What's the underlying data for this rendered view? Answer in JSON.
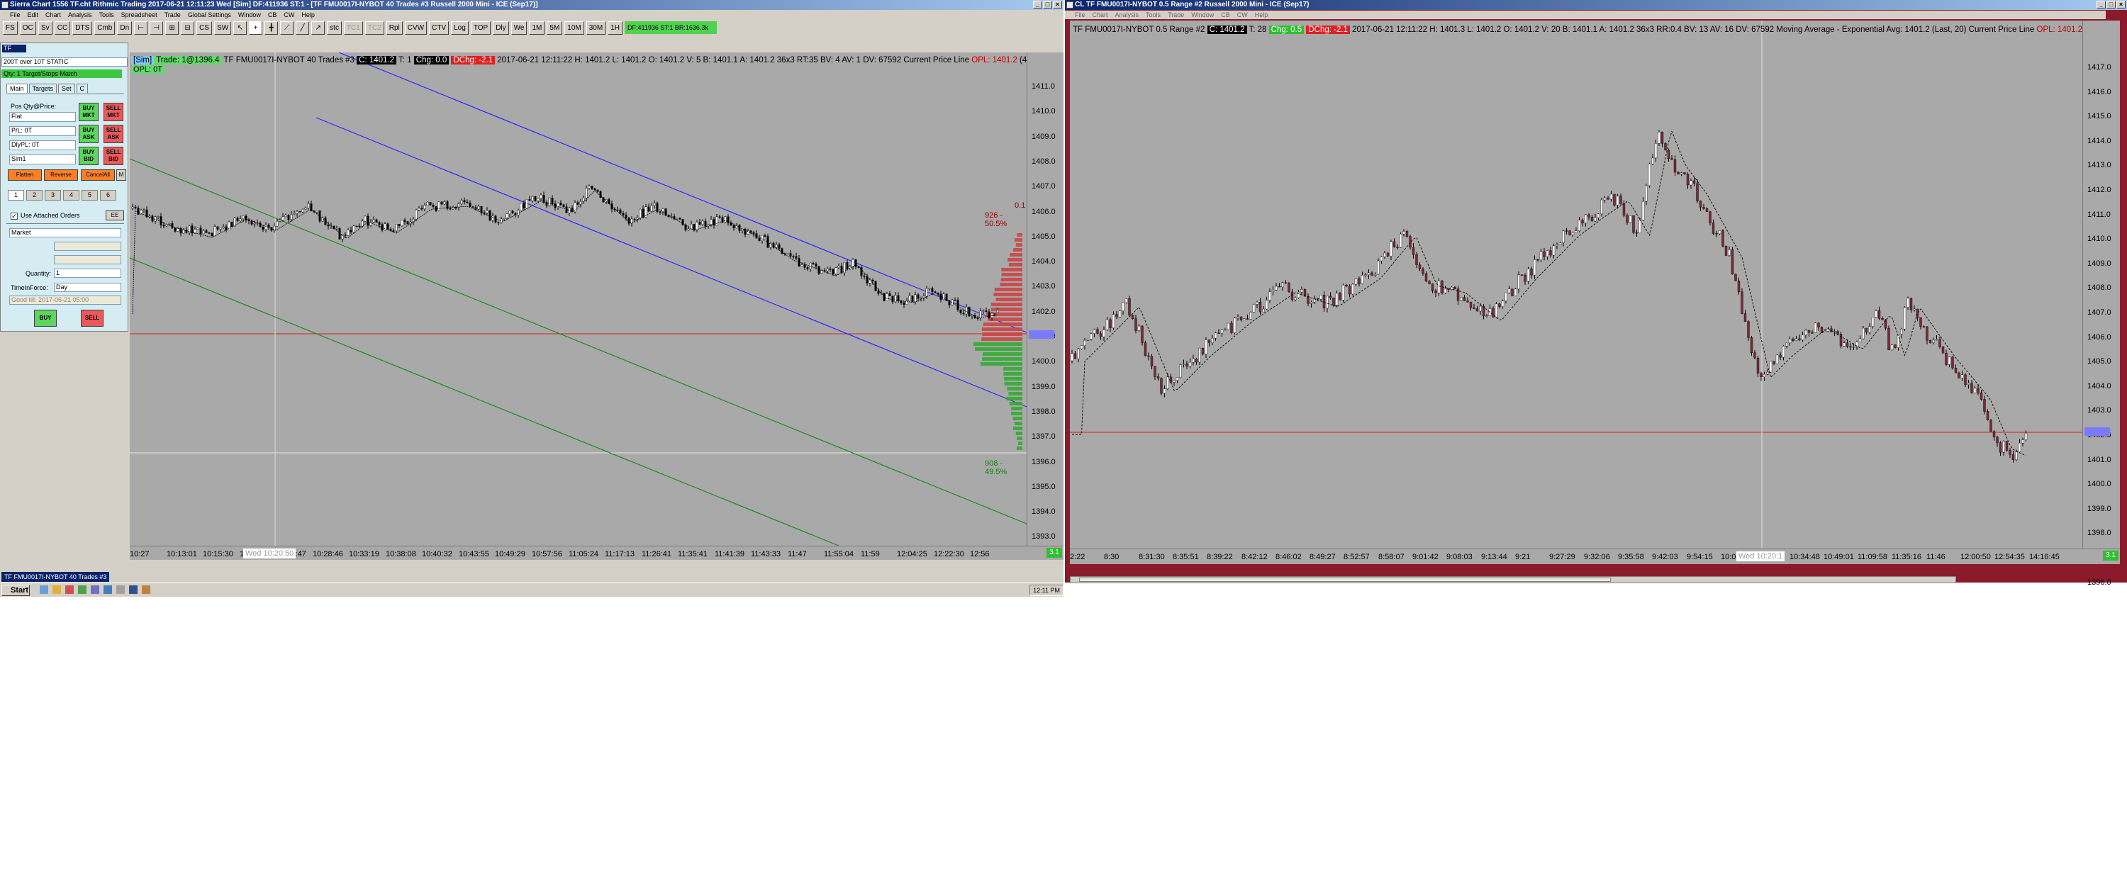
{
  "left_window": {
    "title": "Sierra Chart 1556 TF.cht Rithmic Trading 2017-06-21 12:11:23 Wed [Sim] DF:411936 ST:1 - [TF FMU0017I-NYBOT 40 Trades #3 Russell 2000 Mini - ICE (Sep17)]",
    "menu": [
      "File",
      "Edit",
      "Chart",
      "Analysis",
      "Tools",
      "Spreadsheet",
      "Trade",
      "Global Settings",
      "Window",
      "CB",
      "CW",
      "Help"
    ],
    "toolbar_left": [
      "FS",
      "OC",
      "Sv",
      "CC",
      "DTS",
      "Cmb",
      "Dn"
    ],
    "toolbar_mid": [
      "CS",
      "SW"
    ],
    "toolbar_right": [
      "Rpl",
      "CVW",
      "CTV",
      "Log",
      "TOP",
      "Dly",
      "We",
      "1M",
      "5M",
      "10M",
      "30M",
      "1H"
    ],
    "toolbar_status": "DF:411936 ST:1 BR:1636.3k",
    "trade_window": {
      "mode_tab": "TF",
      "config": "200T over 10T STATIC",
      "target_label": "Qty: 1 Target/Stops Match",
      "tabs": [
        "Main",
        "Targets",
        "Set",
        "C"
      ],
      "pos_label": "Pos Qty@Price:",
      "pos_value": "Flat",
      "pl_value": "P/L: 0T",
      "daily_pl": "DlyPL: 0T",
      "account": "Sim1",
      "buy_mkt": "BUY MKT",
      "sell_mkt": "SELL MKT",
      "buy_ask": "BUY ASK",
      "sell_ask": "SELL ASK",
      "buy_bid": "BUY BID",
      "sell_bid": "SELL BID",
      "flatten": "Flatten",
      "reverse": "Reverse",
      "cancel_all": "CancelAll",
      "m_label": "M",
      "qty_buttons": [
        "1",
        "2",
        "3",
        "4",
        "5",
        "6"
      ],
      "use_attached": "Use Attached Orders",
      "ee": "EE",
      "order_type": "Market",
      "quantity_label": "Quantity:",
      "quantity_value": "1",
      "tif_label": "TimeInForce:",
      "tif_value": "Day",
      "good_til": "Good till: 2017-06-21 05:00",
      "buy": "BUY",
      "sell": "SELL"
    },
    "chart": {
      "sim_tag": "[Sim]",
      "trade_tag": "Trade: 1@1396.4",
      "opl_tag": "OPL: 0T",
      "header_symbol": "TF FMU0017I-NYBOT 40 Trades #3",
      "header_c": "C: 1401.2",
      "header_t": "T: 1",
      "header_chg": "Chg: 0.0",
      "header_dchg": "DChg: -2.1",
      "header_rest": "2017-06-21 12:11:22 H: 1401.2 L: 1401.2 O: 1401.2 V: 5 B: 1401.1 A: 1401.2 36x3 RT:35 BV: 4 AV: 1 DV: 67592 Current Price Line",
      "opl_label": "OPL: 1401.2",
      "opl_tail": "(400",
      "annot_top1": "0.1",
      "annot_top2": "926 - 50.5%",
      "annot_bottom": "908 - 49.5%",
      "y_labels": [
        "1411.0",
        "1410.0",
        "1409.0",
        "1408.0",
        "1407.0",
        "1406.0",
        "1405.0",
        "1404.0",
        "1403.0",
        "1402.0",
        "1401.0",
        "1400.0",
        "1399.0",
        "1398.0",
        "1397.0",
        "1396.0",
        "1395.0",
        "1394.0",
        "1393.0"
      ],
      "price_box": "1401.2",
      "x_labels": [
        "10:27",
        "10:13:01",
        "10:15:30",
        "10",
        "10:24:47",
        "10:28:46",
        "10:33:19",
        "10:38:08",
        "10:40:32",
        "10:43:55",
        "10:49:29",
        "10:57:56",
        "11:05:24",
        "11:17:13",
        "11:26:41",
        "11:35:41",
        "11:41:39",
        "11:43:33",
        "11:47",
        "11:55:04",
        "11:59",
        "12:04:25",
        "12:22:30",
        "12:56"
      ],
      "x_cursor": "Wed  10:20:50",
      "corner": "3.1"
    },
    "sheet_tab": "TF FMU0017I-NYBOT 40 Trades #3"
  },
  "right_window": {
    "title": "CL TF FMU0017I-NYBOT 0.5 Range #2 Russell 2000 Mini - ICE (Sep17)",
    "menu": [
      "File",
      "Chart",
      "Analysis",
      "Tools",
      "Trade",
      "Window",
      "CB",
      "CW",
      "Help"
    ],
    "chart": {
      "header_symbol": "TF FMU0017I-NYBOT 0.5 Range #2",
      "header_c": "C: 1401.2",
      "header_t": "T: 28",
      "header_chg": "Chg: 0.5",
      "header_dchg": "DChg: -2.1",
      "header_rest": "2017-06-21 12:11:22 H: 1401.3 L: 1401.2 O: 1401.2 V: 20 B: 1401.1 A: 1401.2 36x3 RR:0.4 BV: 13 AV: 16 DV: 67592",
      "study_label": "Moving Average - Exponential  Avg: 1401.2  (Last, 20)  Current Price Line",
      "opl_label": "OPL: 1401.2",
      "y_labels": [
        "1417.0",
        "1416.0",
        "1415.0",
        "1414.0",
        "1413.0",
        "1412.0",
        "1411.0",
        "1410.0",
        "1409.0",
        "1408.0",
        "1407.0",
        "1406.0",
        "1405.0",
        "1404.0",
        "1403.0",
        "1402.0",
        "1401.0",
        "1400.0",
        "1399.0",
        "1398.0",
        "1397.0",
        "1396.0"
      ],
      "price_box": "1401.2",
      "x_labels": [
        "2:22",
        "8:30",
        "8:31:30",
        "8:35:51",
        "8:39:22",
        "8:42:12",
        "8:46:02",
        "8:49:27",
        "8:52:57",
        "8:58:07",
        "9:01:42",
        "9:08:03",
        "9:13:44",
        "9:21",
        "9:27:29",
        "9:32:06",
        "9:35:58",
        "9:42:03",
        "9:54:15",
        "10:02:07",
        "10:1",
        "10:34:48",
        "10:49:01",
        "11:09:58",
        "11:35:16",
        "11:46",
        "12:00:50",
        "12:54:35",
        "14:16:45"
      ],
      "x_cursor": "Wed  10:20:1",
      "corner": "3.1"
    }
  },
  "taskbar": {
    "start": "Start",
    "clock": "12:11 PM"
  },
  "colors": {
    "chart_bg": "#a9a9a9",
    "up_candle": "#ffffff",
    "down_candle": "#000000",
    "channel_blue": "#2a2aff",
    "channel_green": "#1d8a1d",
    "price_line": "#d42020",
    "ema": "#000000"
  }
}
